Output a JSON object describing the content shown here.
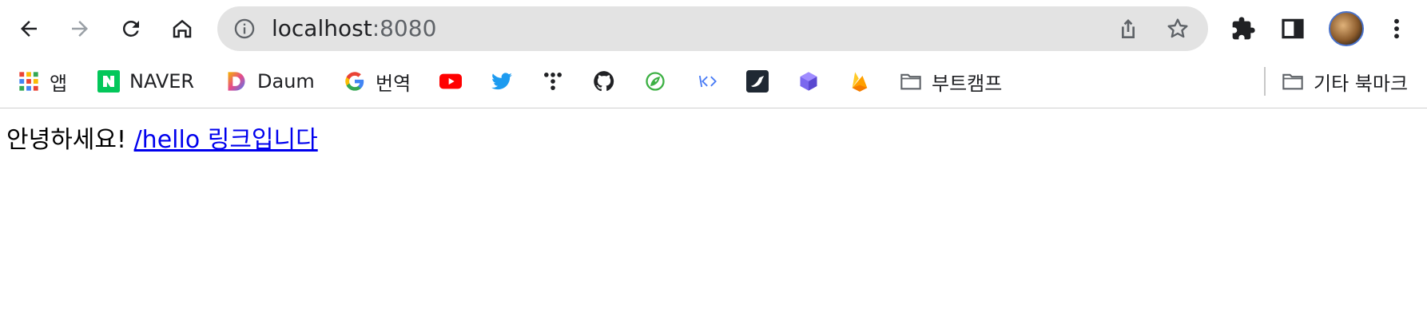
{
  "browser": {
    "url_host": "localhost",
    "url_port": ":8080"
  },
  "toolbar_icons": [
    "back-arrow-icon",
    "forward-arrow-icon",
    "reload-icon",
    "home-icon",
    "info-icon",
    "share-icon",
    "star-icon",
    "extensions-puzzle-icon",
    "side-panel-icon",
    "profile-avatar",
    "kebab-menu-icon"
  ],
  "bookmarks": {
    "items": [
      {
        "label": "앱",
        "icon": "apps-grid-icon"
      },
      {
        "label": "NAVER",
        "icon": "naver-icon"
      },
      {
        "label": "Daum",
        "icon": "daum-icon"
      },
      {
        "label": "번역",
        "icon": "google-icon"
      },
      {
        "label": "",
        "icon": "youtube-icon"
      },
      {
        "label": "",
        "icon": "twitter-icon"
      },
      {
        "label": "",
        "icon": "tistory-icon"
      },
      {
        "label": "",
        "icon": "github-icon"
      },
      {
        "label": "",
        "icon": "leaf-icon"
      },
      {
        "label": "",
        "icon": "code-brackets-icon"
      },
      {
        "label": "",
        "icon": "bird-app-icon"
      },
      {
        "label": "",
        "icon": "cube-icon"
      },
      {
        "label": "",
        "icon": "firebase-icon"
      },
      {
        "label": "부트캠프",
        "icon": "folder-icon"
      }
    ],
    "other": {
      "label": "기타 북마크",
      "icon": "folder-icon"
    }
  },
  "page": {
    "greeting": "안녕하세요!",
    "link_text": "/hello 링크입니다"
  },
  "colors": {
    "omnibox_bg": "#e3e3e3",
    "link": "#0000ee",
    "youtube": "#ff0000",
    "twitter": "#1d9bf0",
    "naver": "#03c75a"
  }
}
